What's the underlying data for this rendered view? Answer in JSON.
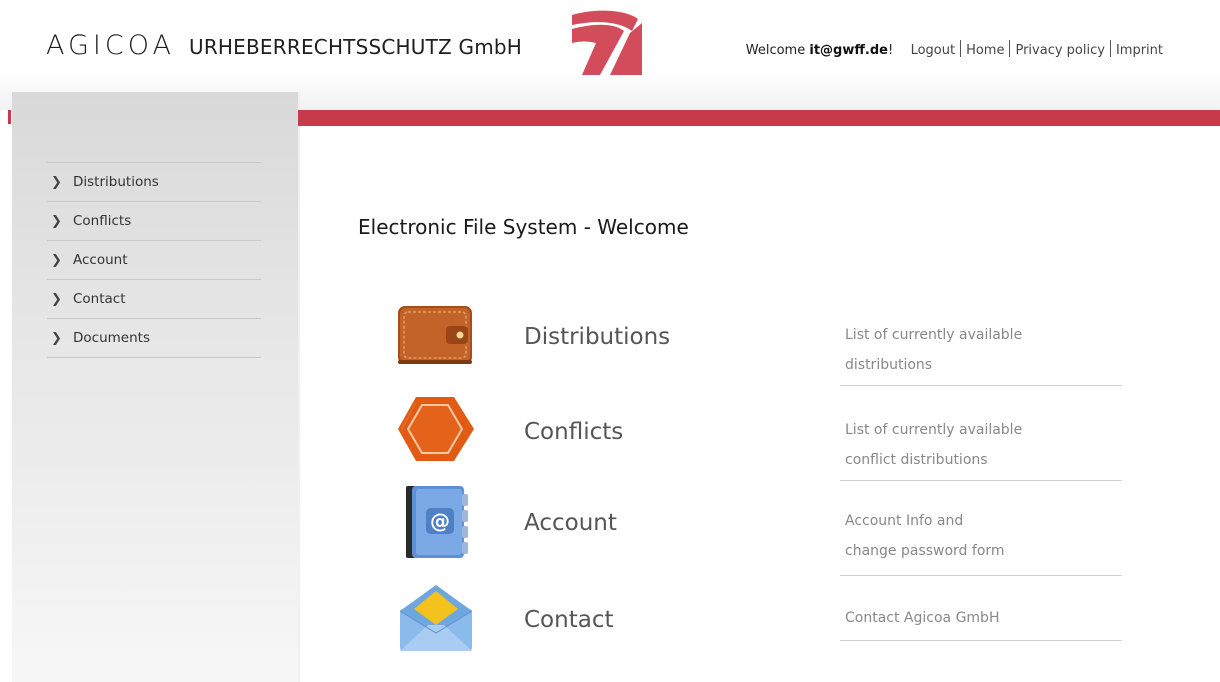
{
  "header": {
    "brand_name": "AGICOA",
    "brand_sub": "URHEBERRECHTSSCHUTZ GmbH",
    "welcome_prefix": "Welcome",
    "user": "it@gwff.de",
    "welcome_suffix": "!",
    "nav": [
      "Logout",
      "Home",
      "Privacy policy",
      "Imprint"
    ]
  },
  "sidebar": {
    "items": [
      {
        "label": "Distributions"
      },
      {
        "label": "Conflicts"
      },
      {
        "label": "Account"
      },
      {
        "label": "Contact"
      },
      {
        "label": "Documents"
      }
    ]
  },
  "main": {
    "title": "Electronic File System - Welcome",
    "features": [
      {
        "icon": "wallet-icon",
        "title": "Distributions",
        "desc1": "List of currently available",
        "desc2": "distributions"
      },
      {
        "icon": "hexagon-icon",
        "title": "Conflicts",
        "desc1": "List of currently available",
        "desc2": "conflict distributions"
      },
      {
        "icon": "address-book-icon",
        "title": "Account",
        "desc1": "Account Info and",
        "desc2": "change password form"
      },
      {
        "icon": "envelope-icon",
        "title": "Contact",
        "desc1": "Contact Agicoa GmbH",
        "desc2": ""
      }
    ]
  },
  "colors": {
    "accent_red": "#c63a4b",
    "sidebar_bg": "#e0e0e0",
    "wallet_brown": "#b85a22",
    "hexagon_orange": "#e4601a",
    "book_blue": "#6e9fdc",
    "envelope_blue": "#8cbcec"
  }
}
